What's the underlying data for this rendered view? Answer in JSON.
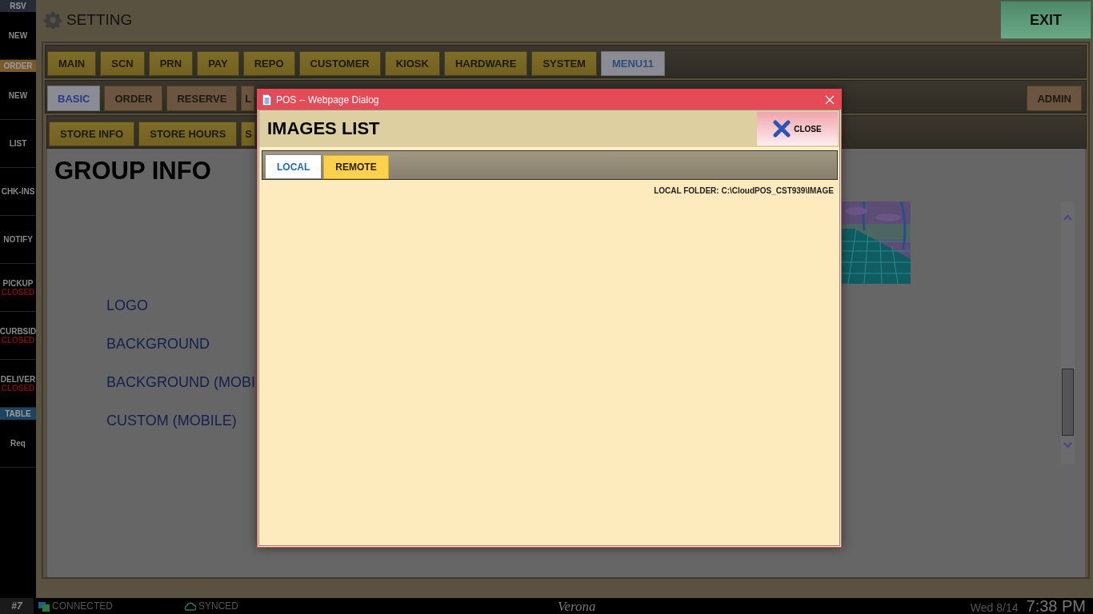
{
  "sidebar": {
    "items": [
      {
        "kind": "header",
        "label": "RSV",
        "color": "#262b38"
      },
      {
        "kind": "item",
        "label": "NEW"
      },
      {
        "kind": "header",
        "label": "ORDER",
        "color": "#7a5a2c"
      },
      {
        "kind": "item",
        "label": "NEW"
      },
      {
        "kind": "item",
        "label": "LIST"
      },
      {
        "kind": "item",
        "label": "CHK-INS"
      },
      {
        "kind": "item",
        "label": "NOTIFY"
      },
      {
        "kind": "item",
        "label": "PICKUP",
        "status": "CLOSED"
      },
      {
        "kind": "item",
        "label": "CURBSID",
        "status": "CLOSED"
      },
      {
        "kind": "item",
        "label": "DELIVER",
        "status": "CLOSED"
      },
      {
        "kind": "header",
        "label": "TABLE",
        "color": "#1d4560"
      },
      {
        "kind": "item",
        "label": "Req"
      }
    ]
  },
  "header": {
    "title": "SETTING",
    "exit_button": "EXIT"
  },
  "main_tabs": [
    {
      "label": "MAIN",
      "selected": false
    },
    {
      "label": "SCN",
      "selected": false
    },
    {
      "label": "PRN",
      "selected": false
    },
    {
      "label": "PAY",
      "selected": false
    },
    {
      "label": "REPO",
      "selected": false
    },
    {
      "label": "CUSTOMER",
      "selected": false
    },
    {
      "label": "KIOSK",
      "selected": false
    },
    {
      "label": "HARDWARE",
      "selected": false
    },
    {
      "label": "SYSTEM",
      "selected": false
    },
    {
      "label": "MENU11",
      "selected": true
    }
  ],
  "sub_tabs": [
    {
      "label": "BASIC",
      "selected": true
    },
    {
      "label": "ORDER",
      "selected": false
    },
    {
      "label": "RESERVE",
      "selected": false
    },
    {
      "label": "L",
      "selected": false
    }
  ],
  "admin_tab": {
    "label": "ADMIN",
    "selected": false
  },
  "section_tabs": [
    {
      "label": "STORE INFO",
      "selected": false
    },
    {
      "label": "STORE HOURS",
      "selected": false
    },
    {
      "label": "S",
      "selected": false
    }
  ],
  "content": {
    "title": "GROUP INFO",
    "fields": [
      "LOGO",
      "BACKGROUND",
      "BACKGROUND (MOBI",
      "CUSTOM (MOBILE)"
    ]
  },
  "dialog": {
    "window_title": "POS -- Webpage Dialog",
    "title": "IMAGES LIST",
    "close_button": "CLOSE",
    "tabs": [
      {
        "label": "LOCAL",
        "selected": true
      },
      {
        "label": "REMOTE",
        "selected": false
      }
    ],
    "folder": "LOCAL FOLDER: C:\\CloudPOS_CST939\\IMAGE"
  },
  "status_bar": {
    "station": "#7",
    "connection": "CONNECTED",
    "sync": "SYNCED",
    "store": "Verona",
    "date": "Wed 8/14",
    "time": "7:38 PM"
  }
}
